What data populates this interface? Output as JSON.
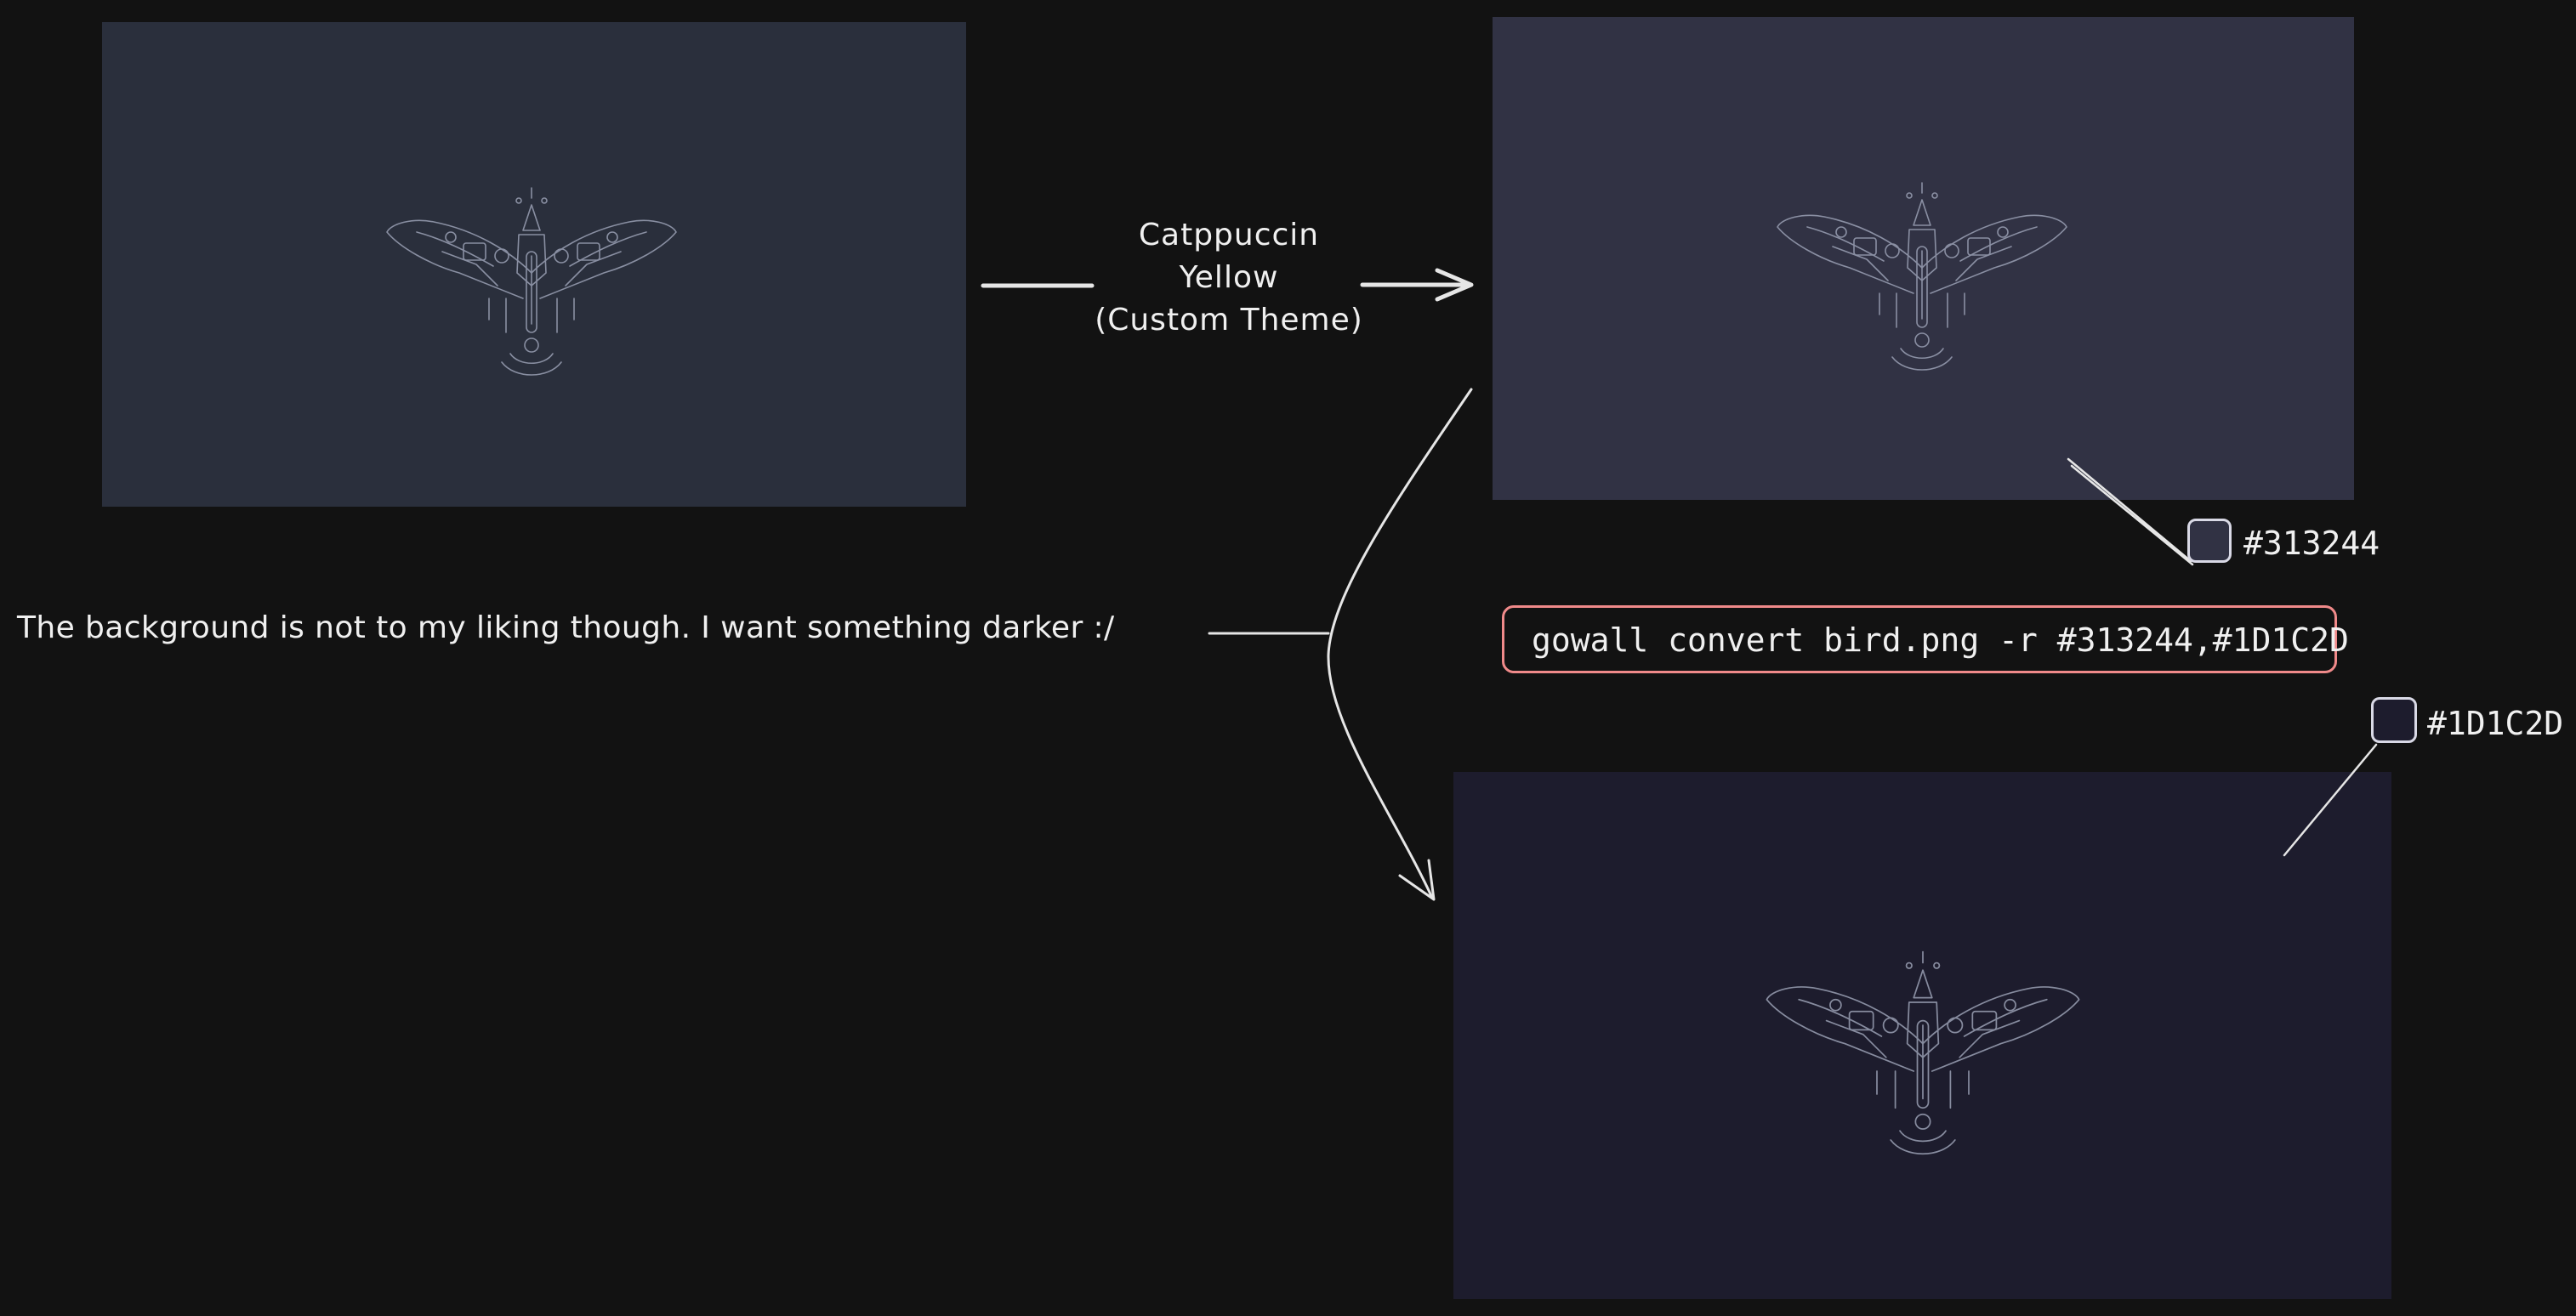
{
  "colors": {
    "canvas_bg": "#121212",
    "panel_original": "#2A2F3C",
    "panel_themed": "#313244",
    "panel_dark": "#1D1C2D",
    "stroke": "#E6E6E6",
    "command_border": "#F08A8A"
  },
  "panels": [
    {
      "label": "original-image",
      "bg": "#2A2F3C",
      "icon": "bird-emblem-icon"
    },
    {
      "label": "themed-image",
      "bg": "#313244",
      "icon": "bird-emblem-icon"
    },
    {
      "label": "darker-image",
      "bg": "#1D1C2D",
      "icon": "bird-emblem-icon"
    }
  ],
  "arrow_label": {
    "line1": "Catppuccin",
    "line2": "Yellow",
    "line3": "(Custom Theme)"
  },
  "note": "The background is not to my liking though. I want something darker :/",
  "command": "gowall convert bird.png -r #313244,#1D1C2D",
  "swatches": {
    "first": {
      "hex": "#313244",
      "color": "#313244"
    },
    "second": {
      "hex": "#1D1C2D",
      "color": "#1D1C2D"
    }
  }
}
